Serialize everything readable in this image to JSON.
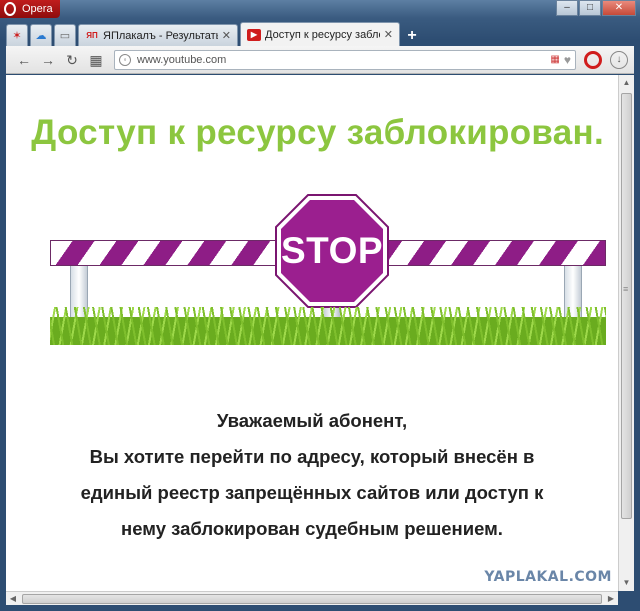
{
  "window": {
    "app_name": "Opera",
    "controls": {
      "minimize": "–",
      "maximize": "□",
      "close": "✕"
    }
  },
  "tabs": [
    {
      "label": "ЯПлакалъ - Результаты п",
      "icon": "yaplakal-icon",
      "favicon_text": "ЯП",
      "active": false
    },
    {
      "label": "Доступ к ресурсу заблоки",
      "icon": "youtube-icon",
      "favicon_text": "▶",
      "active": true
    }
  ],
  "toolbar": {
    "back": "←",
    "forward": "→",
    "reload": "↻",
    "speed_dial": "▦",
    "address": {
      "value": "www.youtube.com"
    }
  },
  "page": {
    "heading": "Доступ к ресурсу заблокирован.",
    "stop_sign": "STOP",
    "message_lines": [
      "Уважаемый абонент,",
      "Вы хотите перейти по адресу, который внесён в",
      "единый реестр запрещённых сайтов или доступ к",
      "нему заблокирован судебным решением."
    ]
  },
  "watermark": "YAPLAKAL.COM",
  "colors": {
    "heading": "#8cc63f",
    "stop_sign": "#9b1f8f",
    "barrier_stripe": "#8e1d86"
  }
}
